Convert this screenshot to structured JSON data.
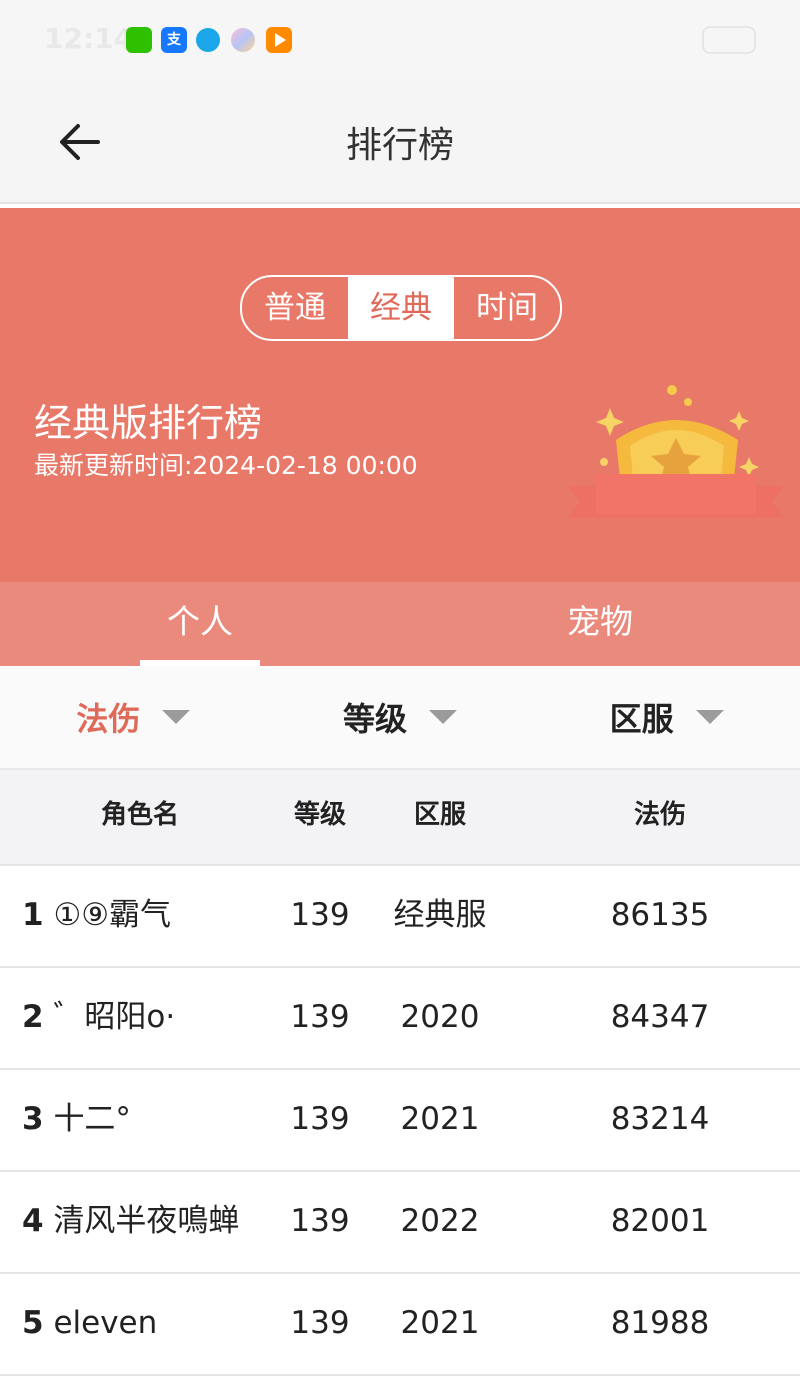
{
  "status_bar": {
    "time": "12:14"
  },
  "header": {
    "title": "排行榜"
  },
  "banner": {
    "segments": [
      {
        "label": "普通",
        "active": false
      },
      {
        "label": "经典",
        "active": true
      },
      {
        "label": "时间",
        "active": false
      }
    ],
    "title": "经典版排行榜",
    "updated": "最新更新时间:2024-02-18 00:00"
  },
  "tabs": [
    {
      "label": "个人",
      "active": true
    },
    {
      "label": "宠物",
      "active": false
    }
  ],
  "filters": [
    {
      "label": "法伤",
      "active": true
    },
    {
      "label": "等级",
      "active": false
    },
    {
      "label": "区服",
      "active": false
    }
  ],
  "table": {
    "columns": [
      "角色名",
      "等级",
      "区服",
      "法伤"
    ],
    "rows": [
      {
        "rank": "1",
        "name": "①⑨霸气",
        "level": "139",
        "server": "经典服",
        "damage": "86135"
      },
      {
        "rank": "2",
        "name": "゛昭阳o·",
        "level": "139",
        "server": "2020",
        "damage": "84347"
      },
      {
        "rank": "3",
        "name": "十二°",
        "level": "139",
        "server": "2021",
        "damage": "83214"
      },
      {
        "rank": "4",
        "name": "清风半夜鳴蝉",
        "level": "139",
        "server": "2022",
        "damage": "82001"
      },
      {
        "rank": "5",
        "name": "eleven",
        "level": "139",
        "server": "2021",
        "damage": "81988"
      }
    ]
  },
  "colors": {
    "accent": "#e87868",
    "tab_bg": "#ea8a7d",
    "active_text": "#e06a5a"
  }
}
